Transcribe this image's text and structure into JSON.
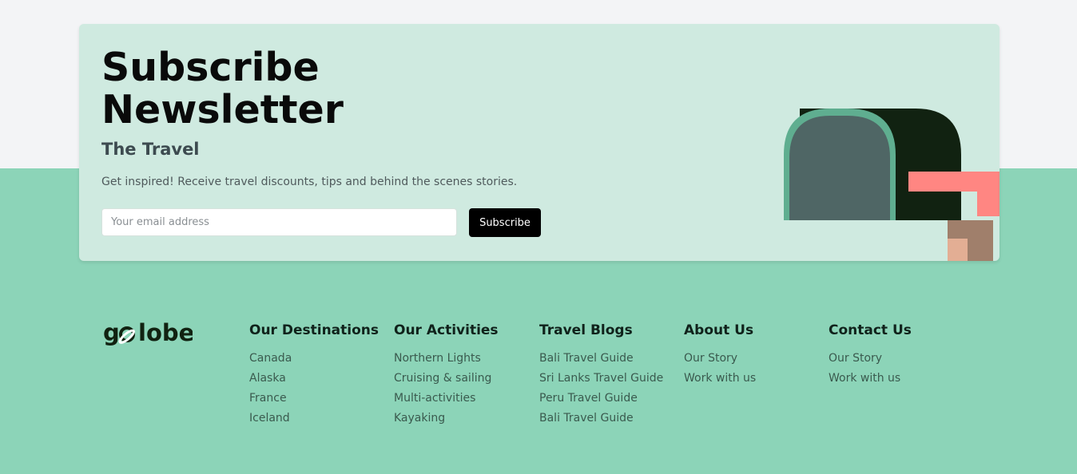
{
  "newsletter": {
    "title_line1": "Subscribe",
    "title_line2": "Newsletter",
    "subtitle": "The Travel",
    "description": "Get inspired! Receive travel discounts, tips and behind the scenes stories.",
    "email_placeholder": "Your email address",
    "email_value": "",
    "subscribe_label": "Subscribe",
    "illustration_icon": "mailbox-illustration"
  },
  "brand": {
    "logo_text": "golobe",
    "logo_icon": "golobe-logo"
  },
  "colors": {
    "page_background": "#8cd4b8",
    "top_band": "#f3f4f6",
    "card_background": "#cfeae0",
    "button": "#000000",
    "mailbox_flag": "#ff8682",
    "mailbox_body": "#112211"
  },
  "footer": {
    "columns": [
      {
        "heading": "Our Destinations",
        "links": [
          "Canada",
          "Alaska",
          "France",
          "Iceland"
        ]
      },
      {
        "heading": "Our Activities",
        "links": [
          "Northern Lights",
          "Cruising & sailing",
          "Multi-activities",
          "Kayaking"
        ]
      },
      {
        "heading": "Travel Blogs",
        "links": [
          "Bali Travel Guide",
          "Sri Lanks Travel Guide",
          "Peru Travel Guide",
          "Bali Travel Guide"
        ]
      },
      {
        "heading": "About Us",
        "links": [
          "Our Story",
          "Work with us"
        ]
      },
      {
        "heading": "Contact Us",
        "links": [
          "Our Story",
          "Work with us"
        ]
      }
    ]
  }
}
